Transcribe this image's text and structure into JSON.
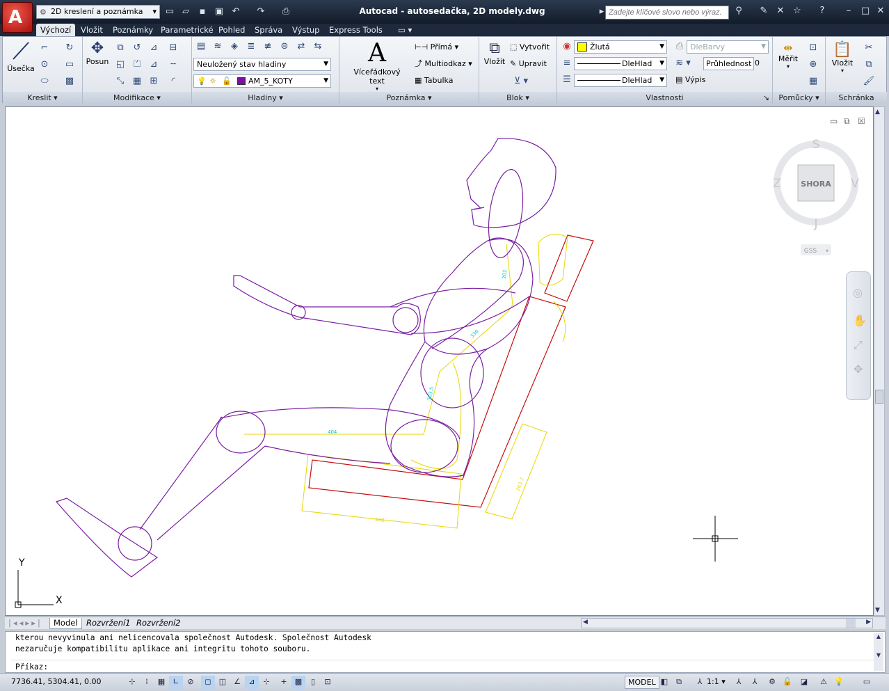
{
  "app": {
    "title": "Autocad - autosedačka, 2D modely.dwg",
    "workspace": "2D kreslení a poznámka",
    "search_placeholder": "Zadejte klíčové slovo nebo výraz."
  },
  "tabs": [
    "Výchozí",
    "Vložit",
    "Poznámky",
    "Parametrické",
    "Pohled",
    "Správa",
    "Výstup",
    "Express Tools"
  ],
  "ribbon": {
    "draw": {
      "panel": "Kreslit",
      "line": "Úsečka"
    },
    "modify": {
      "panel": "Modifikace",
      "move": "Posun"
    },
    "layers": {
      "panel": "Hladiny",
      "state": "Neuložený stav hladiny",
      "layer": "AM_5_KOTY"
    },
    "annotation": {
      "panel": "Poznámka",
      "mtext": "Víceřádkový text",
      "linear": "Přímá",
      "mleader": "Multiodkaz",
      "table": "Tabulka"
    },
    "block": {
      "panel": "Blok",
      "insert": "Vložit",
      "create": "Vytvořit",
      "edit": "Upravit"
    },
    "properties": {
      "panel": "Vlastnosti",
      "color": "Žlutá",
      "color_hex": "#ffff00",
      "linetype": "DleHlad",
      "lineweight": "DleHlad",
      "plotstyle": "DleBarvy",
      "transparency_label": "Průhlednost",
      "transparency_value": "0",
      "list": "Výpis"
    },
    "utilities": {
      "panel": "Pomůcky",
      "measure": "Měřit"
    },
    "clipboard": {
      "panel": "Schránka",
      "paste": "Vložit"
    }
  },
  "viewcube": {
    "north": "S",
    "south": "J",
    "west": "Z",
    "east": "V",
    "face": "SHORA",
    "ucs": "GSS"
  },
  "ucs_icon": {
    "x": "X",
    "y": "Y"
  },
  "dims": {
    "d1": "404",
    "d2": "440",
    "d3": "263,7",
    "d4": "202",
    "d5": "336",
    "d6": "303,5"
  },
  "layout_tabs": [
    "Model",
    "Rozvržení1",
    "Rozvržení2"
  ],
  "command": {
    "line1": "kterou nevyvinula ani nelicencovala společnost Autodesk. Společnost Autodesk",
    "line2": "nezaručuje kompatibilitu aplikace ani integritu tohoto souboru.",
    "prompt": "Příkaz:"
  },
  "status": {
    "coords": "7736.41, 5304.41, 0.00",
    "space": "MODEL",
    "scale": "1:1"
  },
  "colors": {
    "purple": "#7a1fa2",
    "yellow": "#e8d700",
    "red": "#c41010",
    "cyan": "#00c8c8",
    "layer_swatch": "#7a0fa0"
  }
}
